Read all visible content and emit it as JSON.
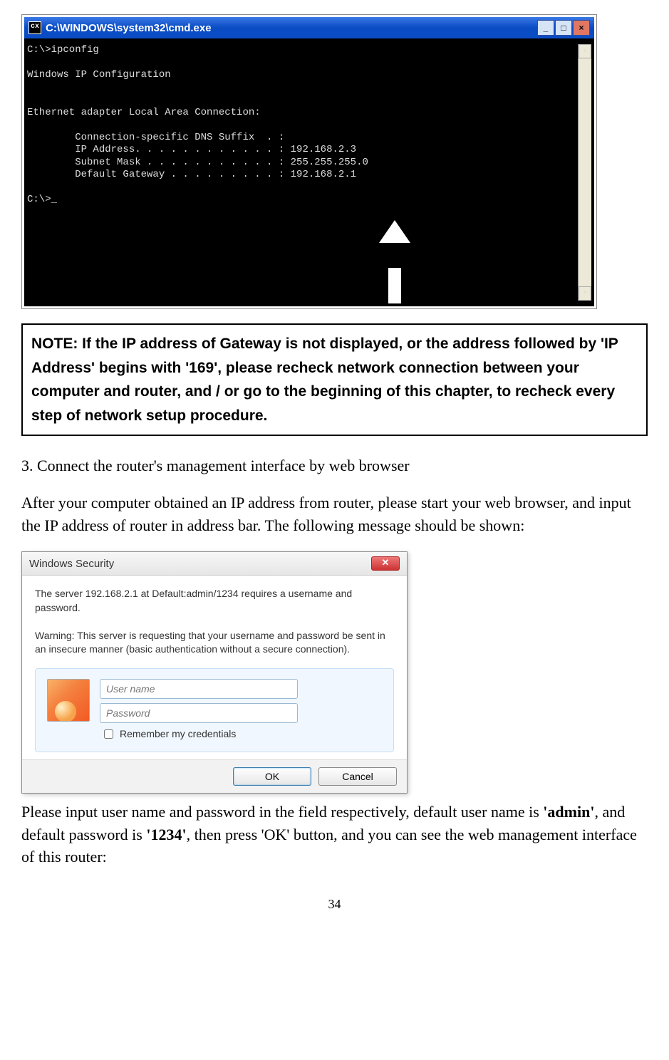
{
  "cmd": {
    "title": "C:\\WINDOWS\\system32\\cmd.exe",
    "icon_label": "cx",
    "output": "C:\\>ipconfig\n\nWindows IP Configuration\n\n\nEthernet adapter Local Area Connection:\n\n        Connection-specific DNS Suffix  . :\n        IP Address. . . . . . . . . . . . : 192.168.2.3\n        Subnet Mask . . . . . . . . . . . : 255.255.255.0\n        Default Gateway . . . . . . . . . : 192.168.2.1\n\nC:\\>_"
  },
  "note": {
    "text": "NOTE: If the IP address of Gateway is not displayed, or the address followed by 'IP Address' begins with '169', please recheck network connection between your computer and router, and / or go to the beginning of this chapter, to recheck every step of network setup procedure."
  },
  "step3": {
    "heading": "3. Connect the router's management interface by web browser",
    "paragraph": "After your computer obtained an IP address from router, please start your web browser, and input the IP address of router in address bar. The following message should be shown:"
  },
  "dialog": {
    "title": "Windows Security",
    "message1": "The server 192.168.2.1 at Default:admin/1234 requires a username and password.",
    "message2": "Warning: This server is requesting that your username and password be sent in an insecure manner (basic authentication without a secure connection).",
    "username_placeholder": "User name",
    "password_placeholder": "Password",
    "remember_label": "Remember my credentials",
    "ok_label": "OK",
    "cancel_label": "Cancel"
  },
  "closing": {
    "part1": "Please input user name and password in the field respectively, default user name is ",
    "admin": "'admin'",
    "part2": ", and default password is ",
    "pw": "'1234'",
    "part3": ", then press 'OK' button, and you can see the web management interface of this router:"
  },
  "page_number": "34"
}
